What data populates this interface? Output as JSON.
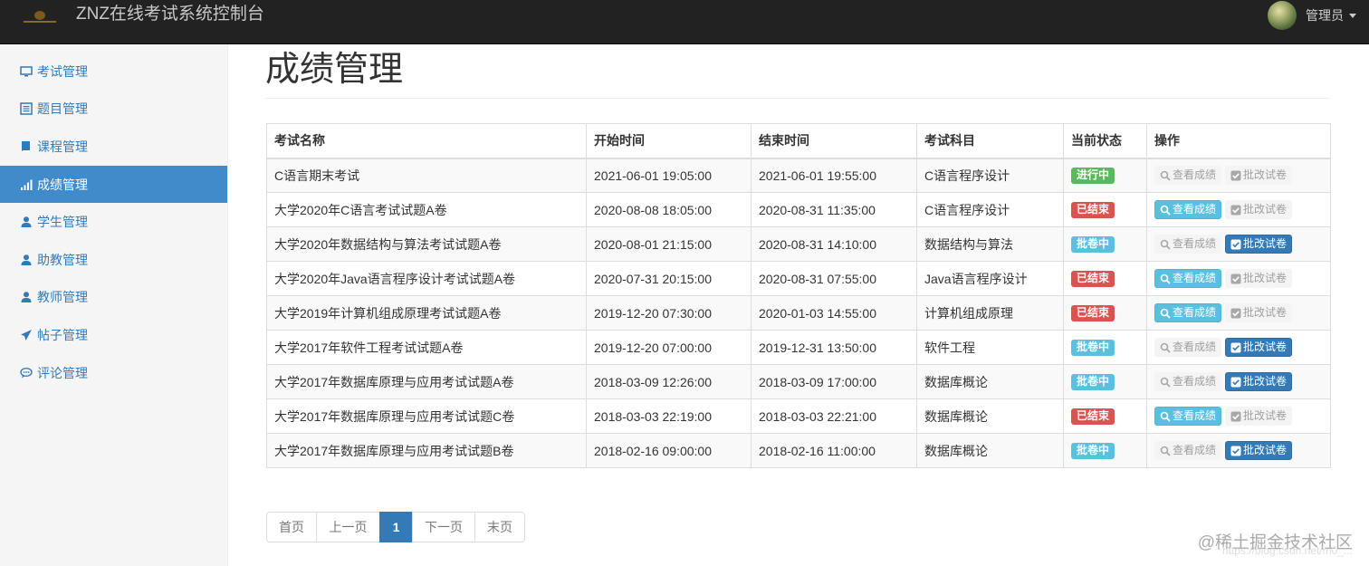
{
  "navbar": {
    "brand": "ZNZ在线考试系统控制台",
    "user_name": "管理员"
  },
  "sidebar": {
    "items": [
      {
        "label": "考试管理",
        "icon": "monitor-icon",
        "active": false
      },
      {
        "label": "题目管理",
        "icon": "list-alt-icon",
        "active": false
      },
      {
        "label": "课程管理",
        "icon": "book-icon",
        "active": false
      },
      {
        "label": "成绩管理",
        "icon": "signal-icon",
        "active": true
      },
      {
        "label": "学生管理",
        "icon": "user-icon",
        "active": false
      },
      {
        "label": "助教管理",
        "icon": "user-icon",
        "active": false
      },
      {
        "label": "教师管理",
        "icon": "user-icon",
        "active": false
      },
      {
        "label": "帖子管理",
        "icon": "send-icon",
        "active": false
      },
      {
        "label": "评论管理",
        "icon": "comment-icon",
        "active": false
      }
    ]
  },
  "main": {
    "title": "成绩管理"
  },
  "table": {
    "headers": [
      "考试名称",
      "开始时间",
      "结束时间",
      "考试科目",
      "当前状态",
      "操作"
    ],
    "view_label": "查看成绩",
    "grade_label": "批改试卷",
    "rows": [
      {
        "name": "C语言期末考试",
        "start": "2021-06-01 19:05:00",
        "end": "2021-06-01 19:55:00",
        "subject": "C语言程序设计",
        "status": "进行中",
        "status_type": "running",
        "view_enabled": false,
        "grade_enabled": false
      },
      {
        "name": "大学2020年C语言考试试题A卷",
        "start": "2020-08-08 18:05:00",
        "end": "2020-08-31 11:35:00",
        "subject": "C语言程序设计",
        "status": "已结束",
        "status_type": "ended",
        "view_enabled": true,
        "grade_enabled": false
      },
      {
        "name": "大学2020年数据结构与算法考试试题A卷",
        "start": "2020-08-01 21:15:00",
        "end": "2020-08-31 14:10:00",
        "subject": "数据结构与算法",
        "status": "批卷中",
        "status_type": "grading",
        "view_enabled": false,
        "grade_enabled": true
      },
      {
        "name": "大学2020年Java语言程序设计考试试题A卷",
        "start": "2020-07-31 20:15:00",
        "end": "2020-08-31 07:55:00",
        "subject": "Java语言程序设计",
        "status": "已结束",
        "status_type": "ended",
        "view_enabled": true,
        "grade_enabled": false
      },
      {
        "name": "大学2019年计算机组成原理考试试题A卷",
        "start": "2019-12-20 07:30:00",
        "end": "2020-01-03 14:55:00",
        "subject": "计算机组成原理",
        "status": "已结束",
        "status_type": "ended",
        "view_enabled": true,
        "grade_enabled": false
      },
      {
        "name": "大学2017年软件工程考试试题A卷",
        "start": "2019-12-20 07:00:00",
        "end": "2019-12-31 13:50:00",
        "subject": "软件工程",
        "status": "批卷中",
        "status_type": "grading",
        "view_enabled": false,
        "grade_enabled": true
      },
      {
        "name": "大学2017年数据库原理与应用考试试题A卷",
        "start": "2018-03-09 12:26:00",
        "end": "2018-03-09 17:00:00",
        "subject": "数据库概论",
        "status": "批卷中",
        "status_type": "grading",
        "view_enabled": false,
        "grade_enabled": true
      },
      {
        "name": "大学2017年数据库原理与应用考试试题C卷",
        "start": "2018-03-03 22:19:00",
        "end": "2018-03-03 22:21:00",
        "subject": "数据库概论",
        "status": "已结束",
        "status_type": "ended",
        "view_enabled": true,
        "grade_enabled": false
      },
      {
        "name": "大学2017年数据库原理与应用考试试题B卷",
        "start": "2018-02-16 09:00:00",
        "end": "2018-02-16 11:00:00",
        "subject": "数据库概论",
        "status": "批卷中",
        "status_type": "grading",
        "view_enabled": false,
        "grade_enabled": true
      }
    ]
  },
  "pagination": {
    "first": "首页",
    "prev": "上一页",
    "current": "1",
    "next": "下一页",
    "last": "末页"
  },
  "watermark": {
    "line1": "@稀土掘金技术社区",
    "line2": "https://blog.csdn.net/m0_..."
  },
  "colors": {
    "navbar_bg": "#222222",
    "sidebar_active": "#428bca",
    "link": "#337ab7",
    "status_running": "#5cb85c",
    "status_ended": "#d9534f",
    "status_grading": "#5bc0de"
  }
}
